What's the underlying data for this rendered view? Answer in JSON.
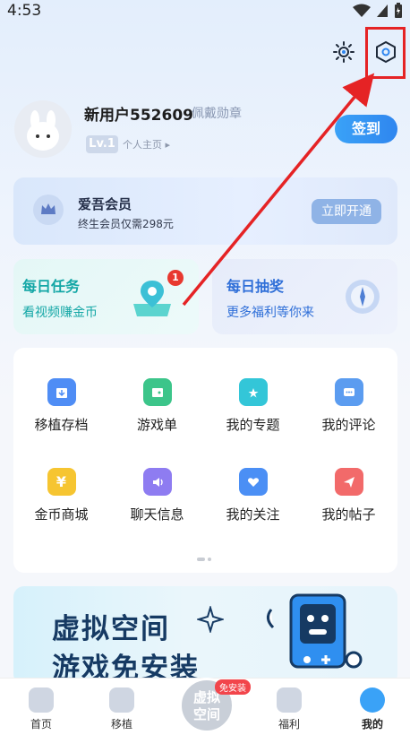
{
  "status_bar": {
    "time": "4:53"
  },
  "profile": {
    "username": "新用户552609",
    "medal_link": "佩戴勋章",
    "level": "Lv.1",
    "homepage_link": "个人主页",
    "checkin_label": "签到"
  },
  "vip": {
    "title": "爱吾会员",
    "subtitle": "终生会员仅需298元",
    "button_label": "立即开通"
  },
  "daily_task": {
    "title": "每日任务",
    "subtitle": "看视频赚金币",
    "badge": "1"
  },
  "daily_lottery": {
    "title": "每日抽奖",
    "subtitle": "更多福利等你来"
  },
  "grid": {
    "items": [
      {
        "label": "移植存档",
        "color": "#4f8df5"
      },
      {
        "label": "游戏单",
        "color": "#3cc58a"
      },
      {
        "label": "我的专题",
        "color": "#33c6d8"
      },
      {
        "label": "我的评论",
        "color": "#5b9cf0"
      },
      {
        "label": "金币商城",
        "color": "#f6c531"
      },
      {
        "label": "聊天信息",
        "color": "#8e7cf1"
      },
      {
        "label": "我的关注",
        "color": "#4b8ff5"
      },
      {
        "label": "我的帖子",
        "color": "#f26a6a"
      }
    ]
  },
  "banner": {
    "line1": "虚拟空间",
    "line2": "游戏免安装"
  },
  "tabbar": {
    "items": [
      {
        "label": "首页"
      },
      {
        "label": "移植"
      },
      {
        "label": "福利"
      },
      {
        "label": "我的"
      }
    ],
    "center_label_1": "虚拟",
    "center_label_2": "空间",
    "install_tag": "免安装"
  },
  "colors": {
    "accent": "#2f86ef",
    "highlight": "#e52325",
    "task_text": "#14a7a6",
    "lottery_text": "#2f6fd8"
  }
}
